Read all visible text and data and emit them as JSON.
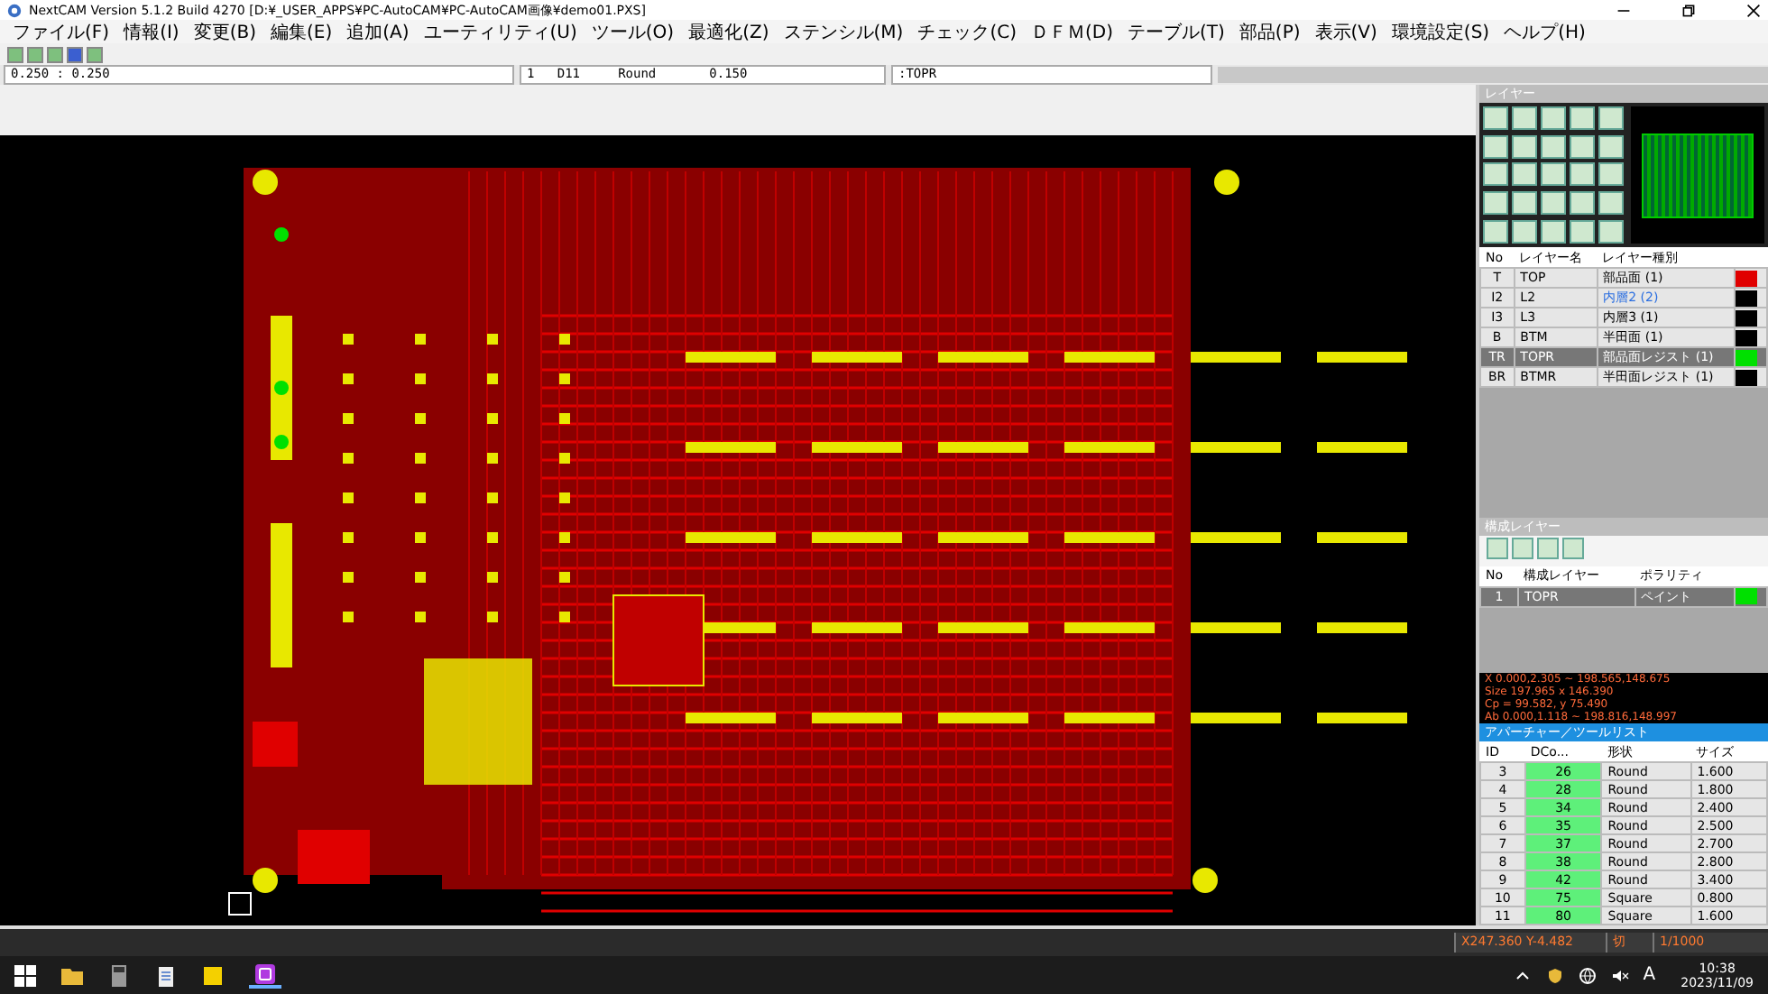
{
  "window": {
    "title": "NextCAM Version 5.1.2 Build 4270 [D:¥_USER_APPS¥PC-AutoCAM¥PC-AutoCAM画像¥demo01.PXS]"
  },
  "menu": [
    "ファイル(F)",
    "情報(I)",
    "変更(B)",
    "編集(E)",
    "追加(A)",
    "ユーティリティ(U)",
    "ツール(O)",
    "最適化(Z)",
    "ステンシル(M)",
    "チェック(C)",
    "ＤＦＭ(D)",
    "テーブル(T)",
    "部品(P)",
    "表示(V)",
    "環境設定(S)",
    "ヘルプ(H)"
  ],
  "selectors": {
    "grid": "0.250 : 0.250",
    "aperture": "1   D11     Round       0.150",
    "layer": ":TOPR"
  },
  "layer_panel": {
    "title": "レイヤー",
    "columns": [
      "No",
      "レイヤー名",
      "レイヤー種別"
    ],
    "rows": [
      {
        "no": "T",
        "name": "TOP",
        "type": "部品面 (1)",
        "color": "#e00000",
        "selected": false,
        "linked": false
      },
      {
        "no": "I2",
        "name": "L2",
        "type": "内層2 (2)",
        "color": "#000000",
        "selected": false,
        "linked": true
      },
      {
        "no": "I3",
        "name": "L3",
        "type": "内層3 (1)",
        "color": "#000000",
        "selected": false,
        "linked": false
      },
      {
        "no": "B",
        "name": "BTM",
        "type": "半田面 (1)",
        "color": "#000000",
        "selected": false,
        "linked": false
      },
      {
        "no": "TR",
        "name": "TOPR",
        "type": "部品面レジスト (1)",
        "color": "#00e000",
        "selected": true,
        "linked": false
      },
      {
        "no": "BR",
        "name": "BTMR",
        "type": "半田面レジスト (1)",
        "color": "#000000",
        "selected": false,
        "linked": false
      }
    ]
  },
  "compose_panel": {
    "title": "構成レイヤー",
    "columns": [
      "No",
      "構成レイヤー",
      "ポラリティ"
    ],
    "rows": [
      {
        "no": "1",
        "name": "TOPR",
        "polarity": "ペイント",
        "color": "#00e000",
        "selected": true
      }
    ]
  },
  "info": [
    "X 0.000,2.305 ~ 198.565,148.675",
    "Size 197.965 x 146.390",
    "Cp = 99.582, y 75.490",
    "Ab 0.000,1.118 ~ 198.816,148.997"
  ],
  "aperture_panel": {
    "title": "アパーチャー／ツールリスト",
    "columns": [
      "ID",
      "DCo...",
      "形状",
      "サイズ"
    ],
    "rows": [
      {
        "id": "3",
        "dcode": "26",
        "shape": "Round",
        "size": "1.600"
      },
      {
        "id": "4",
        "dcode": "28",
        "shape": "Round",
        "size": "1.800"
      },
      {
        "id": "5",
        "dcode": "34",
        "shape": "Round",
        "size": "2.400"
      },
      {
        "id": "6",
        "dcode": "35",
        "shape": "Round",
        "size": "2.500"
      },
      {
        "id": "7",
        "dcode": "37",
        "shape": "Round",
        "size": "2.700"
      },
      {
        "id": "8",
        "dcode": "38",
        "shape": "Round",
        "size": "2.800"
      },
      {
        "id": "9",
        "dcode": "42",
        "shape": "Round",
        "size": "3.400"
      },
      {
        "id": "10",
        "dcode": "75",
        "shape": "Square",
        "size": "0.800"
      },
      {
        "id": "11",
        "dcode": "80",
        "shape": "Square",
        "size": "1.600"
      }
    ]
  },
  "status_bar": {
    "coords": "X247.360 Y-4.482",
    "mode": "切",
    "scale": "1/1000"
  },
  "taskbar": {
    "time": "10:38",
    "date": "2023/11/09",
    "ime": "A"
  }
}
